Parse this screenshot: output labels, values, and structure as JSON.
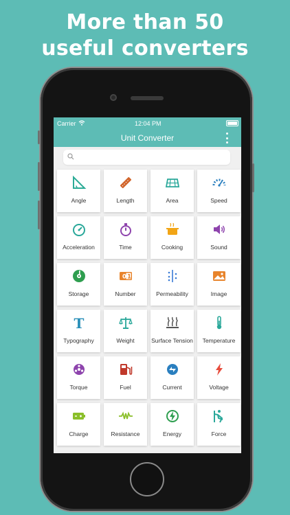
{
  "headline": {
    "line1": "More than 50",
    "line2": "useful converters"
  },
  "status_bar": {
    "carrier": "Carrier",
    "time": "12:04 PM"
  },
  "nav": {
    "title": "Unit Converter"
  },
  "search": {
    "placeholder": ""
  },
  "tiles": [
    {
      "label": "Angle",
      "icon": "angle-icon",
      "color": "#2bab96"
    },
    {
      "label": "Length",
      "icon": "ruler-icon",
      "color": "#d1642a"
    },
    {
      "label": "Area",
      "icon": "area-icon",
      "color": "#2aa89a"
    },
    {
      "label": "Speed",
      "icon": "speedometer-icon",
      "color": "#2a7fbf"
    },
    {
      "label": "Acceleration",
      "icon": "gauge-icon",
      "color": "#2aa89a"
    },
    {
      "label": "Time",
      "icon": "stopwatch-icon",
      "color": "#8e44ad"
    },
    {
      "label": "Cooking",
      "icon": "cooking-pot-icon",
      "color": "#f2a516"
    },
    {
      "label": "Sound",
      "icon": "speaker-icon",
      "color": "#8e44ad"
    },
    {
      "label": "Storage",
      "icon": "disk-icon",
      "color": "#2e9e4f"
    },
    {
      "label": "Number",
      "icon": "number-icon",
      "color": "#e8842c"
    },
    {
      "label": "Permeability",
      "icon": "permeability-icon",
      "color": "#3a7bd5"
    },
    {
      "label": "Image",
      "icon": "image-icon",
      "color": "#e8842c"
    },
    {
      "label": "Typography",
      "icon": "typography-icon",
      "color": "#2a8fb8"
    },
    {
      "label": "Weight",
      "icon": "scale-icon",
      "color": "#2aa89a"
    },
    {
      "label": "Surface Tension",
      "icon": "surface-tension-icon",
      "color": "#555555"
    },
    {
      "label": "Temperature",
      "icon": "thermometer-icon",
      "color": "#2aa89a"
    },
    {
      "label": "Torque",
      "icon": "torque-icon",
      "color": "#8e44ad"
    },
    {
      "label": "Fuel",
      "icon": "fuel-pump-icon",
      "color": "#c0392b"
    },
    {
      "label": "Current",
      "icon": "current-icon",
      "color": "#2a7fbf"
    },
    {
      "label": "Voltage",
      "icon": "lightning-icon",
      "color": "#e74c3c"
    },
    {
      "label": "Charge",
      "icon": "battery-charge-icon",
      "color": "#8bbf2a"
    },
    {
      "label": "Resistance",
      "icon": "resistor-icon",
      "color": "#8bbf2a"
    },
    {
      "label": "Energy",
      "icon": "energy-icon",
      "color": "#2e9e4f"
    },
    {
      "label": "Force",
      "icon": "force-icon",
      "color": "#2aa89a"
    }
  ],
  "colors": {
    "accent": "#5dbcb5"
  }
}
